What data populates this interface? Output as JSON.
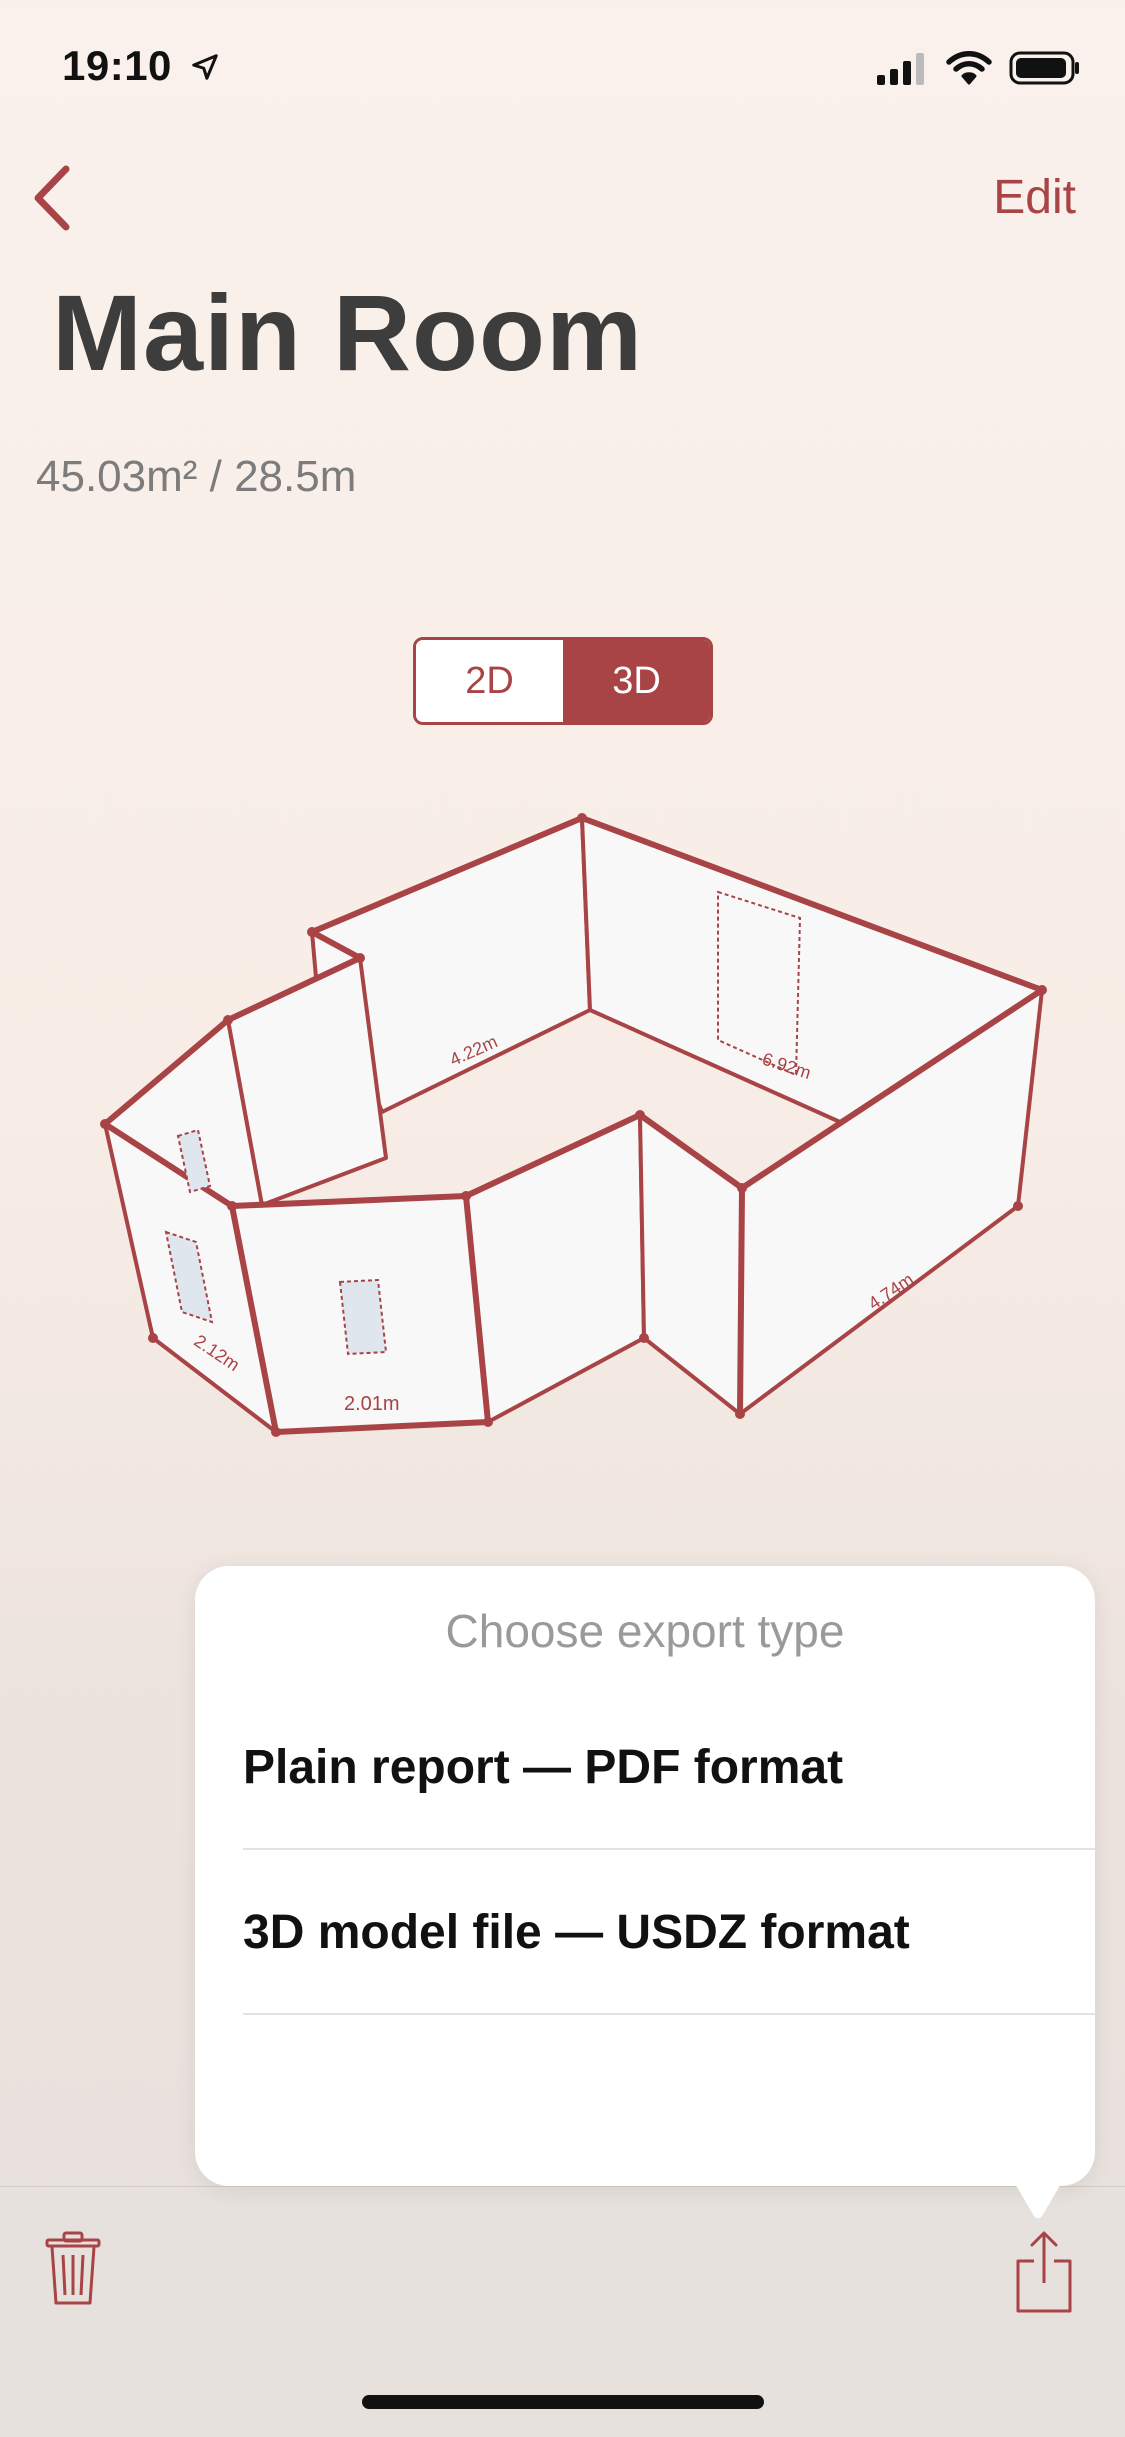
{
  "status_bar": {
    "time": "19:10"
  },
  "nav": {
    "edit_label": "Edit"
  },
  "room": {
    "title": "Main Room",
    "stats": "45.03m² / 28.5m"
  },
  "view_toggle": {
    "options": [
      "2D",
      "3D"
    ],
    "selected": "3D"
  },
  "diagram": {
    "wall_labels": [
      "4.22m",
      "6.92m",
      "4.74m",
      "2.12m",
      "2.01m"
    ]
  },
  "export_sheet": {
    "title": "Choose export type",
    "options": [
      "Plain report — PDF format",
      "3D model file — USDZ format"
    ]
  },
  "colors": {
    "accent": "#a84346",
    "title_text": "#3d3d3d",
    "secondary_text": "#7c7c7c",
    "sheet_background": "#ffffff",
    "toolbar_background": "#e6e1dd"
  },
  "icons": {
    "back": "chevron-left-icon",
    "location": "location-arrow-icon",
    "signal": "cellular-signal-icon",
    "wifi": "wifi-icon",
    "battery": "battery-icon",
    "trash": "trash-icon",
    "share": "share-icon"
  }
}
